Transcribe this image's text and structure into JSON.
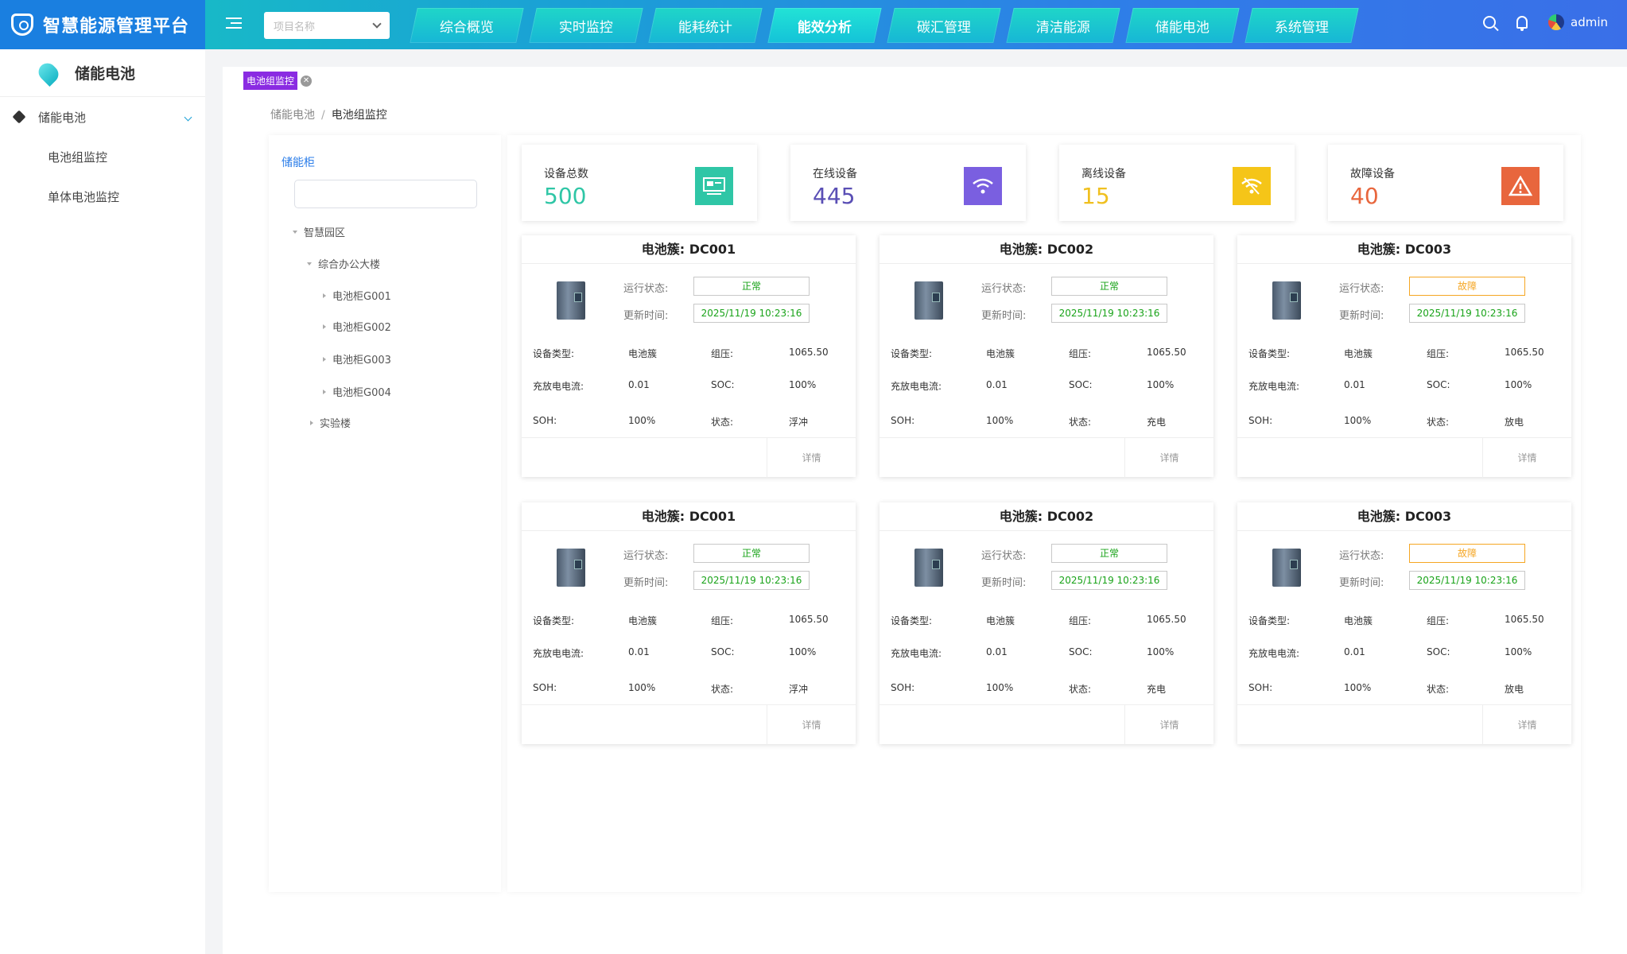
{
  "app": {
    "title": "智慧能源管理平台"
  },
  "header": {
    "project_placeholder": "项目名称",
    "nav": [
      "综合概览",
      "实时监控",
      "能耗统计",
      "能效分析",
      "碳汇管理",
      "清洁能源",
      "储能电池",
      "系统管理"
    ],
    "active_nav": "能效分析",
    "user": "admin"
  },
  "sidebar": {
    "title": "储能电池",
    "group": "储能电池",
    "items": [
      "电池组监控",
      "单体电池监控"
    ]
  },
  "tabs": {
    "active": "电池组监控"
  },
  "breadcrumb": {
    "parent": "储能电池",
    "sep": "/",
    "current": "电池组监控"
  },
  "tree": {
    "title": "储能柜",
    "search_value": "",
    "nodes": {
      "root": "智慧园区",
      "building": "综合办公大楼",
      "c1": "电池柜G001",
      "c2": "电池柜G002",
      "c3": "电池柜G003",
      "c4": "电池柜G004",
      "lab": "实验楼"
    }
  },
  "stats": [
    {
      "label": "设备总数",
      "value": "500",
      "color": "#2fc6a6",
      "icon": "monitor-icon"
    },
    {
      "label": "在线设备",
      "value": "445",
      "color": "#7a5fe0",
      "icon": "wifi-icon"
    },
    {
      "label": "离线设备",
      "value": "15",
      "color": "#f5c518",
      "icon": "wifi-off-icon"
    },
    {
      "label": "故障设备",
      "value": "40",
      "color": "#e8663d",
      "icon": "warning-icon"
    }
  ],
  "card_labels": {
    "status": "运行状态:",
    "updated": "更新时间:",
    "type": "设备类型:",
    "voltage": "组压:",
    "current": "充放电电流:",
    "soc": "SOC:",
    "soh": "SOH:",
    "state": "状态:",
    "detail": "详情"
  },
  "cards": [
    {
      "title": "电池簇: DC001",
      "status": "正常",
      "status_color": "green",
      "time": "2025/11/19 10:23:16",
      "type": "电池簇",
      "voltage": "1065.50",
      "current": "0.01",
      "soc": "100%",
      "soh": "100%",
      "state": "浮冲"
    },
    {
      "title": "电池簇: DC002",
      "status": "正常",
      "status_color": "green",
      "time": "2025/11/19 10:23:16",
      "type": "电池簇",
      "voltage": "1065.50",
      "current": "0.01",
      "soc": "100%",
      "soh": "100%",
      "state": "充电"
    },
    {
      "title": "电池簇: DC003",
      "status": "故障",
      "status_color": "orange",
      "time": "2025/11/19 10:23:16",
      "type": "电池簇",
      "voltage": "1065.50",
      "current": "0.01",
      "soc": "100%",
      "soh": "100%",
      "state": "放电"
    },
    {
      "title": "电池簇: DC001",
      "status": "正常",
      "status_color": "green",
      "time": "2025/11/19 10:23:16",
      "type": "电池簇",
      "voltage": "1065.50",
      "current": "0.01",
      "soc": "100%",
      "soh": "100%",
      "state": "浮冲"
    },
    {
      "title": "电池簇: DC002",
      "status": "正常",
      "status_color": "green",
      "time": "2025/11/19 10:23:16",
      "type": "电池簇",
      "voltage": "1065.50",
      "current": "0.01",
      "soc": "100%",
      "soh": "100%",
      "state": "充电"
    },
    {
      "title": "电池簇: DC003",
      "status": "故障",
      "status_color": "orange",
      "time": "2025/11/19 10:23:16",
      "type": "电池簇",
      "voltage": "1065.50",
      "current": "0.01",
      "soc": "100%",
      "soh": "100%",
      "state": "放电"
    }
  ]
}
